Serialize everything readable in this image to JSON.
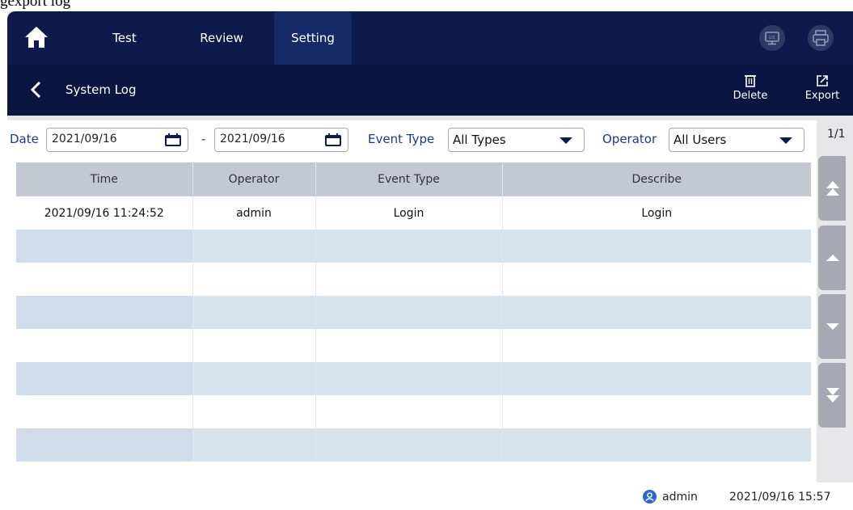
{
  "caption": "gexport log",
  "nav": {
    "tabs": [
      {
        "label": "Test"
      },
      {
        "label": "Review"
      },
      {
        "label": "Setting"
      }
    ],
    "active_tab": "Setting",
    "right_buttons": [
      "lis-monitor-icon",
      "printer-icon"
    ],
    "lis_label": "LIS"
  },
  "subbar": {
    "title": "System Log",
    "delete_label": "Delete",
    "export_label": "Export"
  },
  "filters": {
    "date_label": "Date",
    "date_from": "2021/09/16",
    "date_sep": "-",
    "date_to": "2021/09/16",
    "event_label": "Event Type",
    "event_value": "All Types",
    "operator_label": "Operator",
    "operator_value": "All Users"
  },
  "table": {
    "headers": [
      "Time",
      "Operator",
      "Event Type",
      "Describe"
    ],
    "rows": [
      [
        "2021/09/16 11:24:52",
        "admin",
        "Login",
        "Login"
      ],
      [
        "",
        "",
        "",
        ""
      ],
      [
        "",
        "",
        "",
        ""
      ],
      [
        "",
        "",
        "",
        ""
      ],
      [
        "",
        "",
        "",
        ""
      ],
      [
        "",
        "",
        "",
        ""
      ],
      [
        "",
        "",
        "",
        ""
      ],
      [
        "",
        "",
        "",
        ""
      ]
    ]
  },
  "pager": {
    "page": "1/1"
  },
  "status": {
    "user": "admin",
    "datetime": "2021/09/16 15:57"
  },
  "colors": {
    "topbar": "#0d1a4b",
    "active_tab": "#152a66",
    "label_blue": "#1b3a86",
    "row_alt": "#d6e2ec",
    "header": "#c3c8d2",
    "pager_button": "#a7a9b2"
  }
}
